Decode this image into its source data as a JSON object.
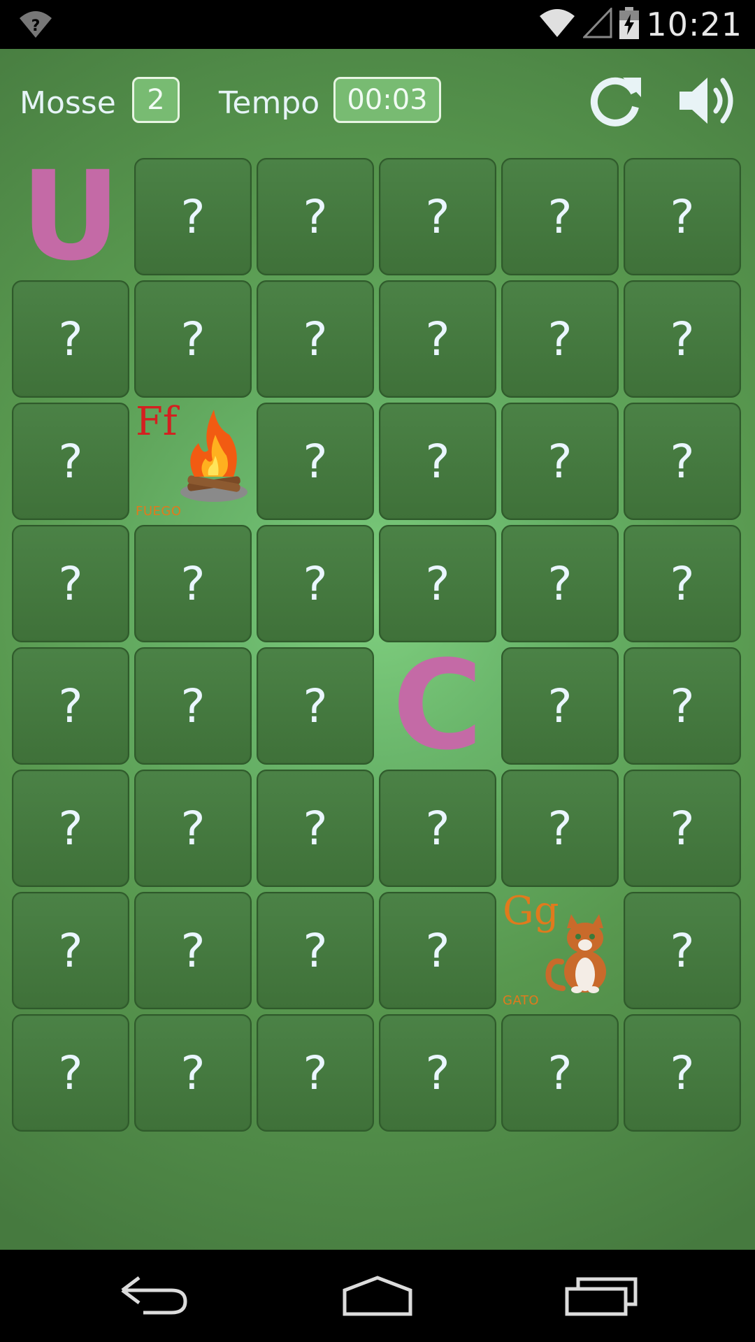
{
  "status_bar": {
    "time": "10:21",
    "icons": [
      "wifi-question-icon",
      "wifi-icon",
      "signal-icon",
      "battery-charging-icon"
    ]
  },
  "hud": {
    "moves_label": "Mosse",
    "moves_value": "2",
    "time_label": "Tempo",
    "time_value": "00:03",
    "restart_icon": "refresh-icon",
    "sound_icon": "speaker-icon"
  },
  "board": {
    "columns": 6,
    "rows": 8,
    "hidden_symbol": "?",
    "colors": {
      "card": "#45783f",
      "card_border": "#2f5a2b",
      "question": "#eaf6ff"
    },
    "revealed": [
      {
        "row": 0,
        "col": 0,
        "kind": "letter",
        "glyph": "U",
        "color": "#c46aa6"
      },
      {
        "row": 2,
        "col": 1,
        "kind": "word",
        "letters": "Ff",
        "word": "FUEGO",
        "picture": "campfire-icon",
        "letter_color": "#d42020"
      },
      {
        "row": 4,
        "col": 3,
        "kind": "letter",
        "glyph": "C",
        "color": "#c46aa6"
      },
      {
        "row": 6,
        "col": 4,
        "kind": "word",
        "letters": "Gg",
        "word": "GATO",
        "picture": "cat-icon",
        "letter_color": "#e07a1d"
      }
    ]
  },
  "nav_bar": {
    "buttons": [
      "back-icon",
      "home-icon",
      "recents-icon"
    ]
  }
}
